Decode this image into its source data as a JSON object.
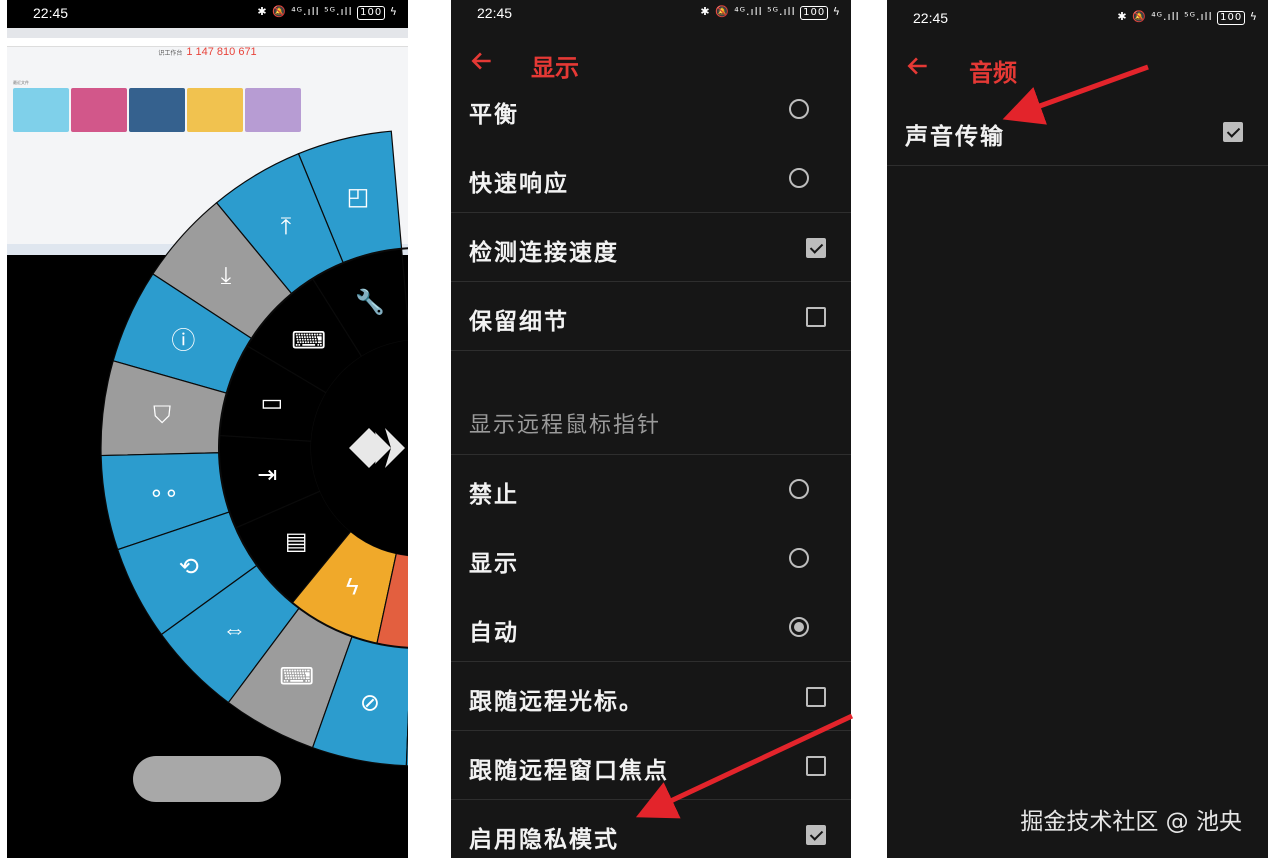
{
  "status": {
    "time": "22:45",
    "icons": "✱ 🔕 ⁴ᴳ.ıll ⁵ᴳ.ıll",
    "battery": "100"
  },
  "remote": {
    "headline_label": "识工作台",
    "headline_id": "1 147 810 671",
    "recent_label": "最近文件"
  },
  "wheel": {
    "colors": {
      "blue": "#2c9cce",
      "gray": "#9c9c9c",
      "orange": "#f0a92a",
      "red": "#e35f3f",
      "dark": "#000000"
    },
    "outer_icons": [
      "screenshot-icon",
      "upload-icon",
      "download-icon",
      "info-icon",
      "shield-icon",
      "nodes-icon",
      "restore-screen-icon",
      "resize-screen-icon",
      "privacy-screen-icon",
      "hide-icon",
      "record-icon"
    ],
    "inner_icons": [
      "wrench-icon",
      "keyboard-mouse-icon",
      "monitor-icon",
      "file-transfer-icon",
      "chat-icon",
      "lightning-icon",
      "close-icon"
    ]
  },
  "display_screen": {
    "title": "显示",
    "rows": [
      {
        "label": "平衡",
        "control": "radio",
        "checked": false
      },
      {
        "label": "快速响应",
        "control": "radio",
        "checked": false
      },
      {
        "label": "检测连接速度",
        "control": "checkbox",
        "checked": true
      },
      {
        "label": "保留细节",
        "control": "checkbox",
        "checked": false
      },
      {
        "label": "显示远程鼠标指针",
        "control": "header"
      },
      {
        "label": "禁止",
        "control": "radio",
        "checked": false
      },
      {
        "label": "显示",
        "control": "radio",
        "checked": false
      },
      {
        "label": "自动",
        "control": "radio",
        "checked": true
      },
      {
        "label": "跟随远程光标。",
        "control": "checkbox",
        "checked": false
      },
      {
        "label": "跟随远程窗口焦点",
        "control": "checkbox",
        "checked": false
      },
      {
        "label": "启用隐私模式",
        "control": "checkbox",
        "checked": true
      }
    ]
  },
  "audio_screen": {
    "title": "音频",
    "rows": [
      {
        "label": "声音传输",
        "control": "checkbox",
        "checked": true
      }
    ]
  },
  "watermark": "掘金技术社区 @ 池央",
  "accent": "#e53935"
}
